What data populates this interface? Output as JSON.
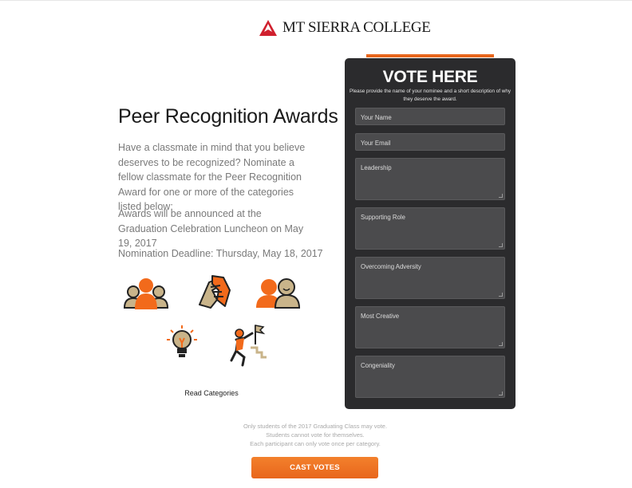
{
  "header": {
    "logo_text": "MT SIERRA COLLEGE",
    "logo_icon": "red-triangle-mountain-icon"
  },
  "main": {
    "title": "Peer Recognition Awards",
    "intro": "Have a classmate in mind that you believe deserves to be recognized? Nominate a fellow classmate for the Peer Recognition Award for one or more of the categories listed below:",
    "announcement": "Awards will be announced at the Graduation Celebration Luncheon on May 19, 2017",
    "deadline": "Nomination Deadline: Thursday, May 18, 2017",
    "category_icons": [
      "group-leadership-icon",
      "handshake-icon",
      "two-people-icon",
      "lightbulb-icon",
      "climber-flag-icon"
    ],
    "read_categories_link": "Read Categories"
  },
  "vote_panel": {
    "title": "VOTE HERE",
    "subtitle": "Please provide the name of your nominee and a short description of why they deserve the award.",
    "fields": [
      {
        "placeholder": "Your Name"
      },
      {
        "placeholder": "Your Email"
      },
      {
        "placeholder": "Leadership"
      },
      {
        "placeholder": "Supporting Role"
      },
      {
        "placeholder": "Overcoming Adversity"
      },
      {
        "placeholder": "Most Creative"
      },
      {
        "placeholder": "Congeniality"
      }
    ]
  },
  "footer": {
    "notes": [
      "Only students of the 2017 Graduating Class may vote.",
      "Students cannot vote for themselves.",
      "Each participant can only vote once per category."
    ],
    "submit_label": "CAST VOTES"
  },
  "colors": {
    "accent_orange": "#e8661c",
    "panel_dark": "#2b2b2d",
    "field_gray": "#4b4b4d",
    "logo_red": "#d0202e",
    "icon_tan": "#c9b48a"
  }
}
